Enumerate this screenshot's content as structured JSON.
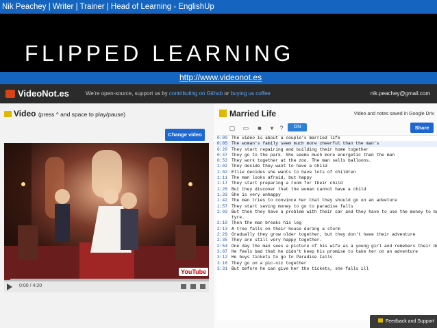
{
  "header": {
    "byline": "Nik Peachey | Writer | Trainer | Head of Learning - EnglishUp",
    "title": "FLIPPED LEARNING",
    "url": "http://www.videonot.es"
  },
  "app": {
    "logo": "VideoNot.es",
    "tagline_pre": "We're open-source, support us by ",
    "tagline_link1": "contributing on Github",
    "tagline_mid": " or ",
    "tagline_link2": "buying us coffee",
    "account": "nik.peachey@gmail.com"
  },
  "video_panel": {
    "heading": "Video",
    "heading_sub": "(press ^ and space to play/pause)",
    "change_button": "Change video",
    "time": "0:00 / 4:20",
    "youtube": "YouTube",
    "progress_fraction": 0.03
  },
  "notes_panel": {
    "title": "Married Life",
    "saved_status": "Video and notes saved in Google Driv",
    "toggle": "ON",
    "share_button": "Share",
    "feedback": "Feedback and Support"
  },
  "notes": [
    {
      "ts": "0:00",
      "text": "The video is about a couple's married life"
    },
    {
      "ts": "0:05",
      "text": "The woman's family seem much more cheerful than the man's"
    },
    {
      "ts": "0:20",
      "text": "They start repairing and building their home together"
    },
    {
      "ts": "0:37",
      "text": "They go to the park. She seems much more energetic than the man"
    },
    {
      "ts": "0:53",
      "text": "They work together at the zoo. The man sells balloons."
    },
    {
      "ts": "1:02",
      "text": "They decide they want to have a child"
    },
    {
      "ts": "1:02",
      "text": "Ellie decides she wants to have lots of children"
    },
    {
      "ts": "1:11",
      "text": "The man looks afraid, but happy"
    },
    {
      "ts": "1:17",
      "text": "They start preparing a room for their child"
    },
    {
      "ts": "1:26",
      "text": "But they discover that the woman cannot have a child"
    },
    {
      "ts": "1:33",
      "text": "She is very unhappy"
    },
    {
      "ts": "1:42",
      "text": "The man tries to convince her that they should go on an adveture"
    },
    {
      "ts": "1:57",
      "text": "They start saving money to go to paradise falls"
    },
    {
      "ts": "2:03",
      "text": "But then they have a problem with their car and they have to use the money to buy a new"
    },
    {
      "ts": "",
      "text": "tyre."
    },
    {
      "ts": "2:10",
      "text": "Then the man breaks his leg"
    },
    {
      "ts": "2:13",
      "text": "A tree falls on their house during a storm"
    },
    {
      "ts": "2:29",
      "text": "Gradually they grow older together, but they don't have their adventure"
    },
    {
      "ts": "2:35",
      "text": "They are still very happy together."
    },
    {
      "ts": "2:54",
      "text": "One day the man sees a picture of his wife as a young girl and remebers their dream"
    },
    {
      "ts": "3:07",
      "text": "He feels bad that he didn't keep his promise to take her on an adventure"
    },
    {
      "ts": "3:12",
      "text": "He buys tickets to go to Paradise Falls"
    },
    {
      "ts": "3:16",
      "text": "They go on a pic-nic together"
    },
    {
      "ts": "3:31",
      "text": "But before he can give her the tickets, she falls ill"
    }
  ]
}
